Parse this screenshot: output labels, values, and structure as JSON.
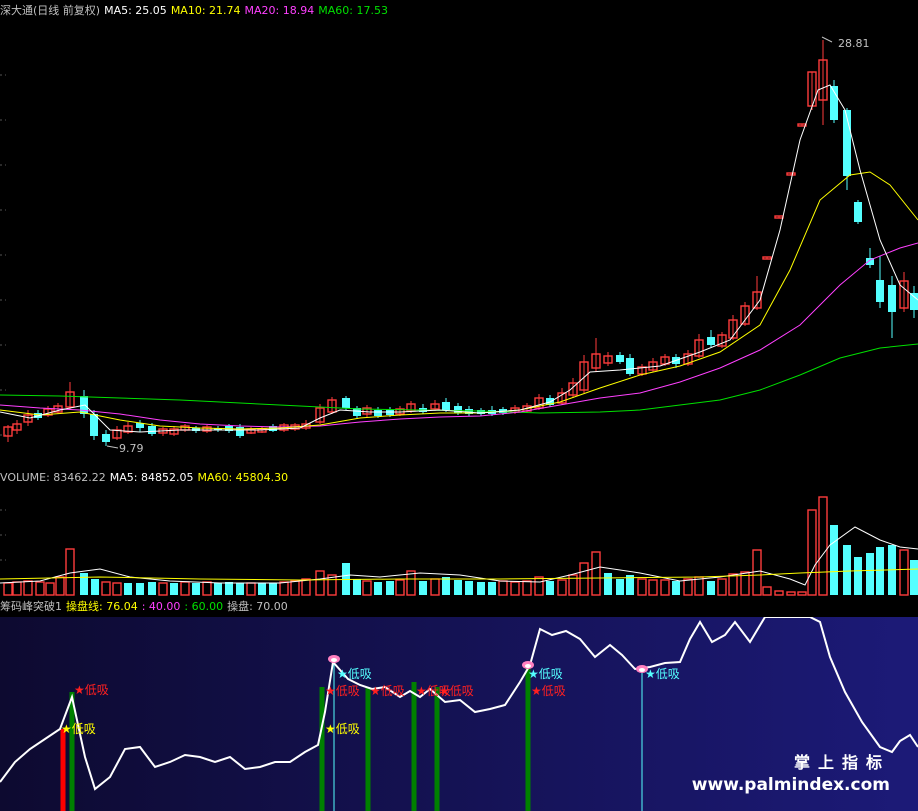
{
  "price_header": {
    "title": "深大通(日线 前复权)",
    "ma5": "MA5: 25.05",
    "ma10": "MA10: 21.74",
    "ma20": "MA20: 18.94",
    "ma60": "MA60: 17.53"
  },
  "price_labels": {
    "high": "28.81",
    "low": "9.79"
  },
  "volume_header": {
    "volume": "VOLUME: 83462.22",
    "ma5": "MA5: 84852.05",
    "ma60": "MA60: 45804.30"
  },
  "indicator_header": {
    "name": "筹码峰突破1",
    "line": "操盘线: 76.04",
    "v40": ": 40.00",
    "v60": ": 60.00",
    "v70": "操盘: 70.00"
  },
  "signals": {
    "low_buy": "低吸"
  },
  "watermark": {
    "cn": "掌上指标",
    "url": "www.palmindex.com"
  },
  "colors": {
    "up": "#ff3c3c",
    "down": "#54ffff",
    "ma5": "#ffffff",
    "ma10": "#ffff00",
    "ma20": "#ff40ff",
    "ma60": "#00e000",
    "volume_ma60": "#ffff00",
    "indicator_line": "#ffffff",
    "signal_star_red": "#ff2020",
    "signal_star_yellow": "#ffff00",
    "signal_text_cyan": "#54ffff",
    "bar_green": "#008000",
    "bar_red": "#ff0000",
    "panel_bg_left": "#100c38",
    "panel_bg_right": "#1a1870"
  },
  "chart_data": {
    "type": "candlestick",
    "title": "深大通(日线 前复权)",
    "price_extremes": {
      "high": 28.81,
      "low": 9.79
    },
    "moving_averages": {
      "MA5": 25.05,
      "MA10": 21.74,
      "MA20": 18.94,
      "MA60": 17.53
    },
    "volume": {
      "last": 83462.22,
      "MA5": 84852.05,
      "MA60": 45804.3
    },
    "indicator": {
      "name": "筹码峰突破1",
      "操盘线": 76.04,
      "level_1": 40.0,
      "level_2": 60.0,
      "操盘": 70.0
    },
    "signal_label": "低吸"
  }
}
